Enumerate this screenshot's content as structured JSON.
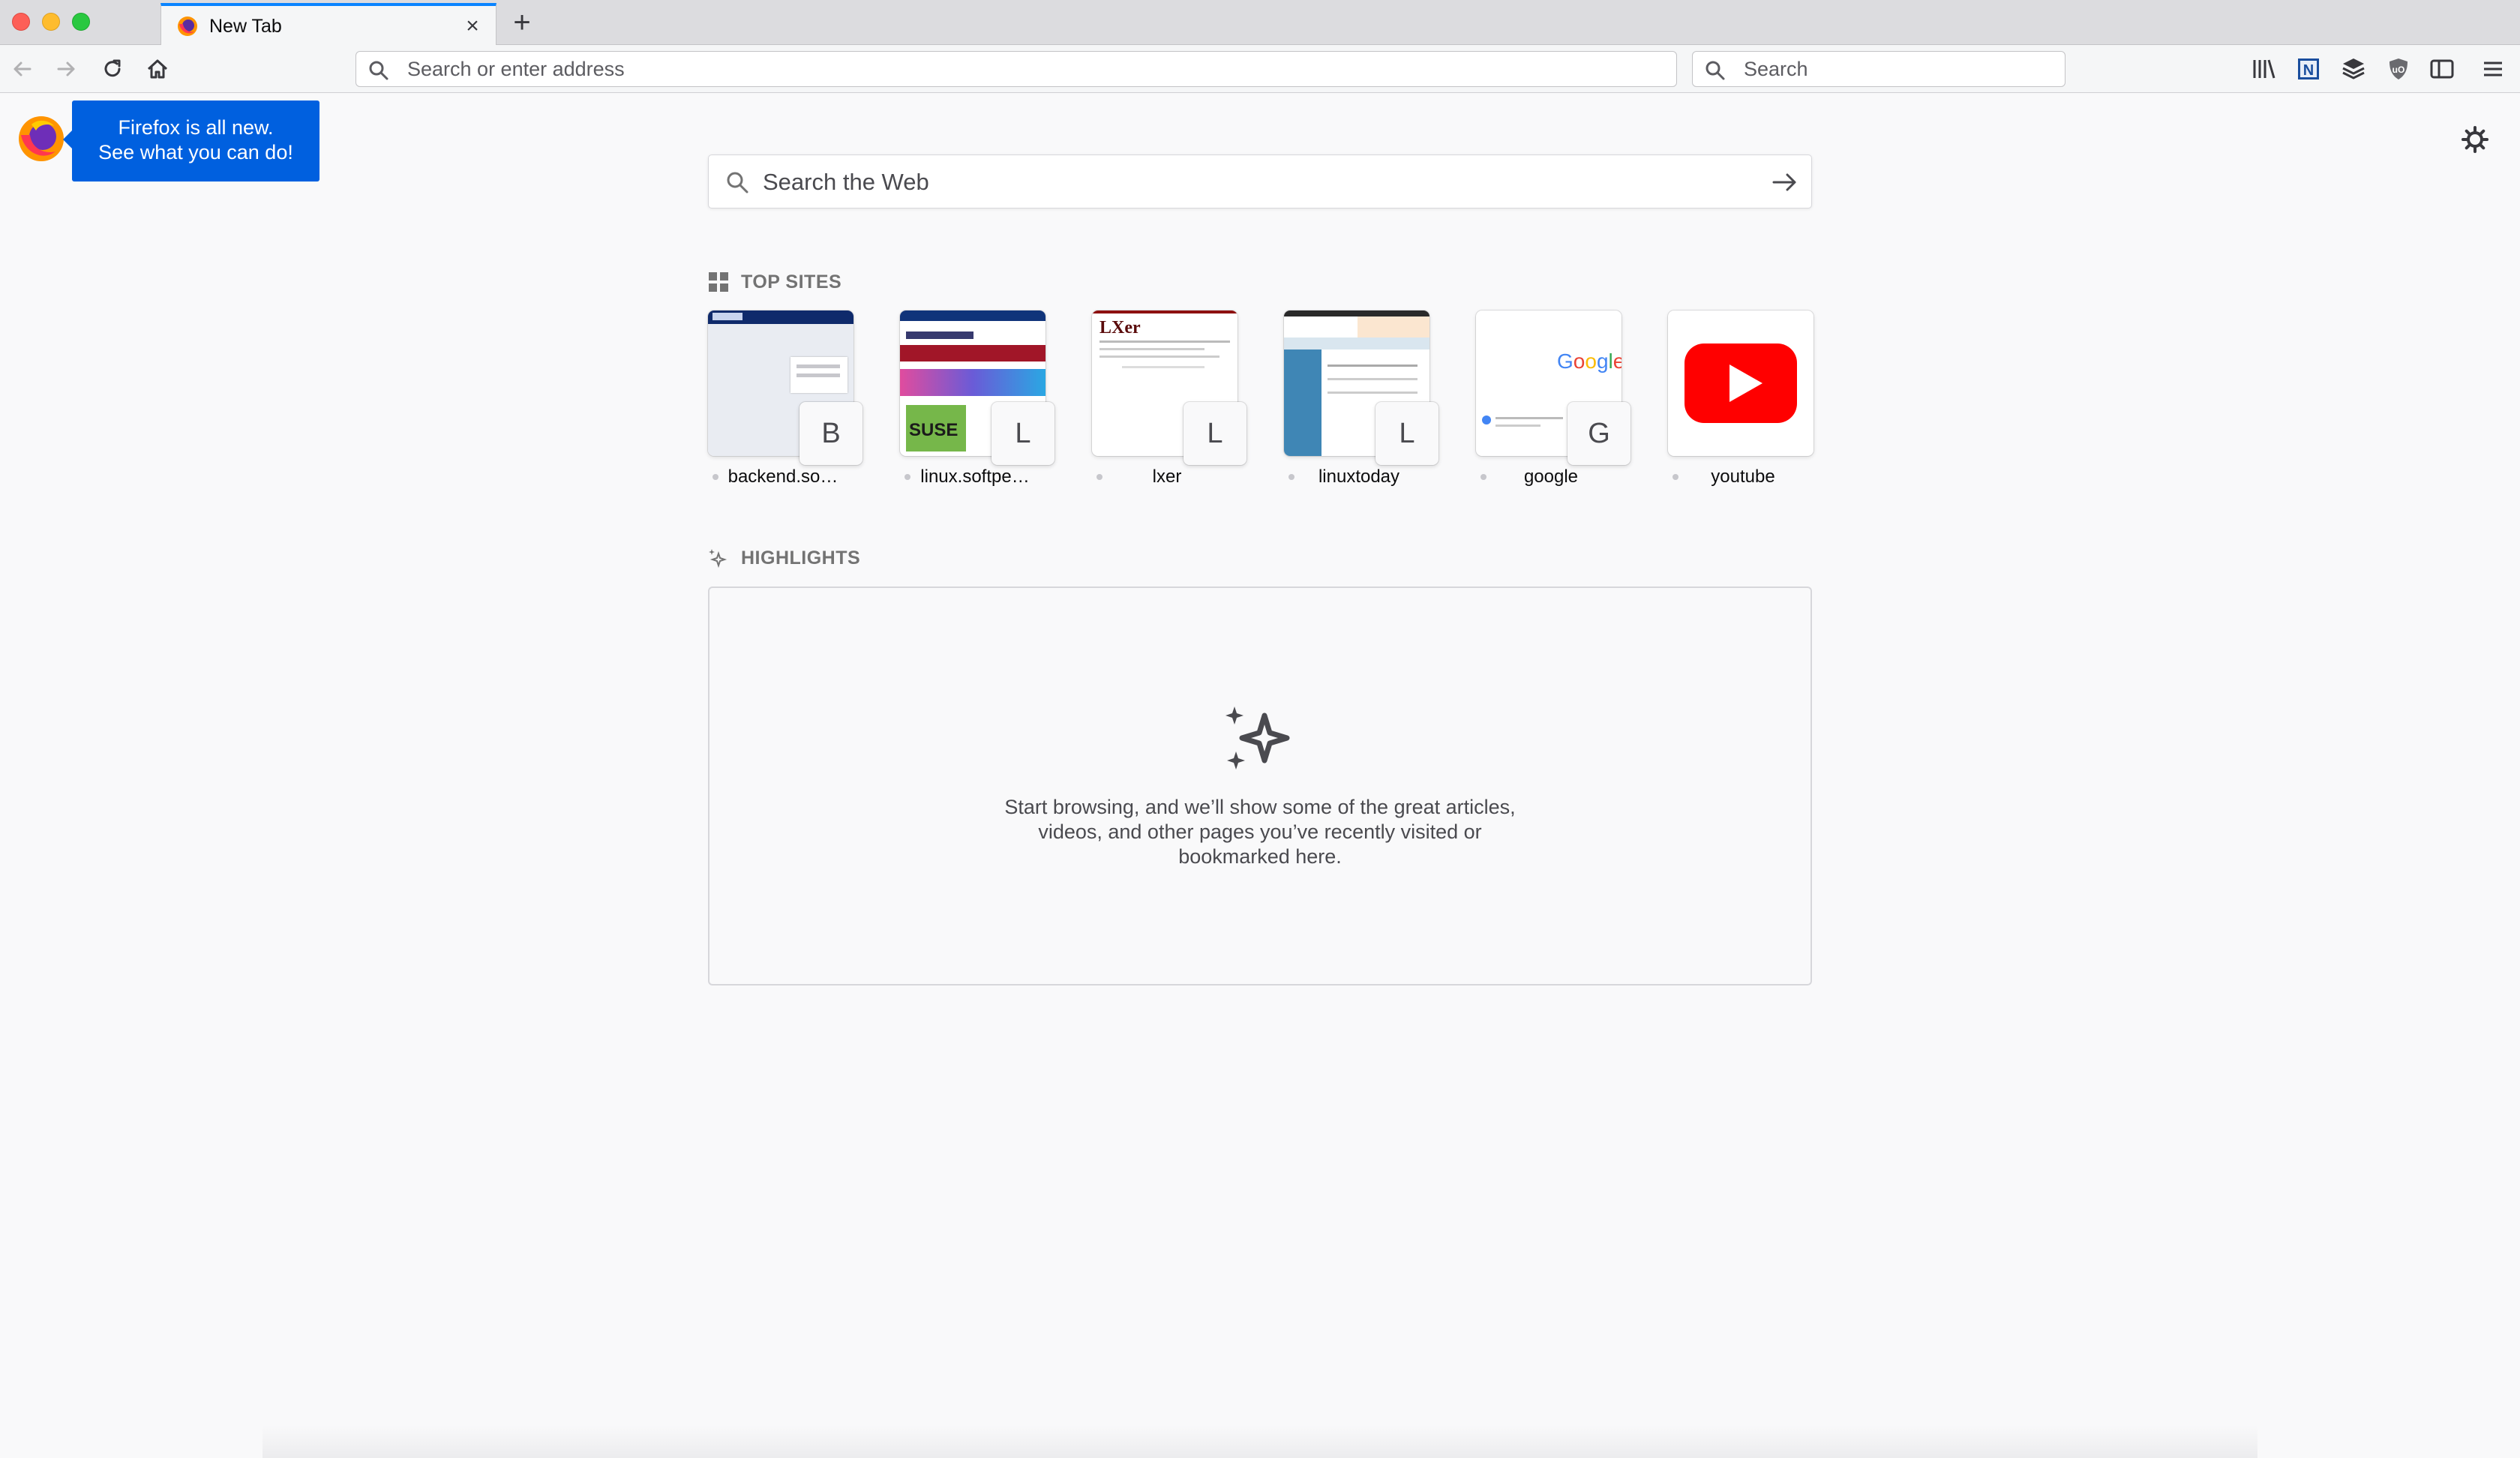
{
  "tab": {
    "title": "New Tab"
  },
  "navbar": {
    "address_placeholder": "Search or enter address",
    "search_placeholder": "Search"
  },
  "whatsnew": {
    "line1": "Firefox is all new.",
    "line2": "See what you can do!"
  },
  "websearch": {
    "placeholder": "Search the Web"
  },
  "top_sites": {
    "title": "TOP SITES",
    "items": [
      {
        "label": "backend.so…",
        "letter": "B"
      },
      {
        "label": "linux.softpe…",
        "letter": "L"
      },
      {
        "label": "lxer",
        "letter": "L"
      },
      {
        "label": "linuxtoday",
        "letter": "L"
      },
      {
        "label": "google",
        "letter": "G"
      },
      {
        "label": "youtube",
        "letter": ""
      }
    ]
  },
  "highlights": {
    "title": "HIGHLIGHTS",
    "empty_text": "Start browsing, and we’ll show some of the great articles,\nvideos, and other pages you’ve recently visited or\nbookmarked here."
  },
  "colors": {
    "accent": "#0a84ff",
    "callout": "#0060df",
    "youtube": "#ff0000"
  },
  "icons": {
    "toolbar": [
      "library-icon",
      "news-extension-icon",
      "pocket-stack-icon",
      "ublock-shield-icon",
      "sidebar-icon",
      "hamburger-menu-icon"
    ]
  }
}
